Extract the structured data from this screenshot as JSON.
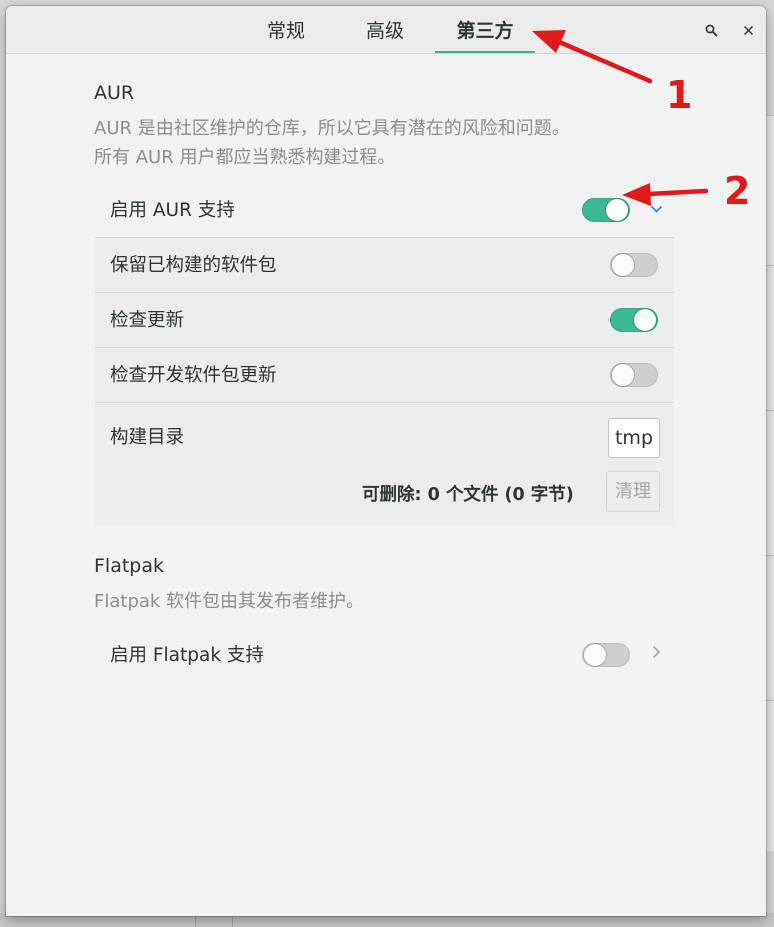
{
  "header": {
    "tabs": [
      {
        "label": "常规"
      },
      {
        "label": "高级"
      },
      {
        "label": "第三方"
      }
    ],
    "active_tab": "第三方",
    "search_icon": "search-icon",
    "close_icon": "close-icon"
  },
  "aur": {
    "title": "AUR",
    "description_line1": "AUR 是由社区维护的仓库，所以它具有潜在的风险和问题。",
    "description_line2": "所有 AUR 用户都应当熟悉构建过程。",
    "enable_label": "启用 AUR 支持",
    "enable_on": true,
    "keep_built_label": "保留已构建的软件包",
    "keep_built_on": false,
    "check_updates_label": "检查更新",
    "check_updates_on": true,
    "check_dev_updates_label": "检查开发软件包更新",
    "check_dev_updates_on": false,
    "build_dir_label": "构建目录",
    "build_dir_value": "tmp",
    "removable_info": "可删除:  0 个文件  (0 字节)",
    "clean_label": "清理"
  },
  "flatpak": {
    "title": "Flatpak",
    "description": "Flatpak 软件包由其发布者维护。",
    "enable_label": "启用 Flatpak 支持",
    "enable_on": false
  },
  "annotations": {
    "arrow1_number": "1",
    "arrow2_number": "2",
    "color": "#e01a1a"
  },
  "colors": {
    "accent": "#3cb896",
    "chevron": "#3584e4"
  }
}
